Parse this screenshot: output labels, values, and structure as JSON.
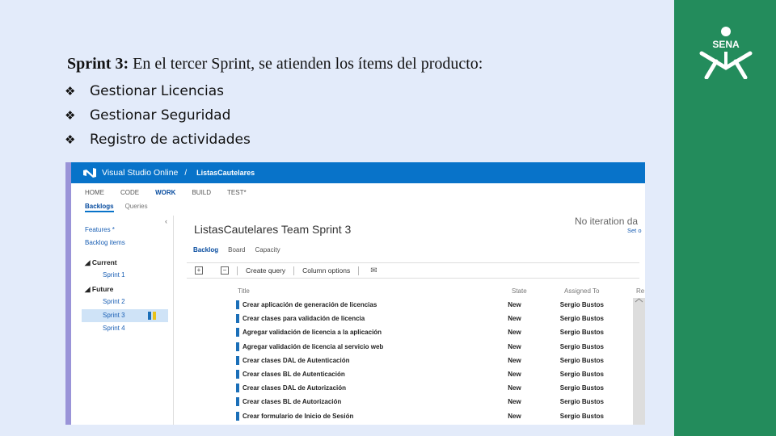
{
  "slide": {
    "heading_bold": "Sprint 3:",
    "heading_rest": " En el tercer Sprint, se atienden los ítems del producto:",
    "bullets": [
      "Gestionar Licencias",
      "Gestionar Seguridad",
      "Registro de actividades"
    ],
    "logo_text": "SENA",
    "band_color": "#238c5c"
  },
  "vso": {
    "app_name": "Visual Studio Online",
    "separator": "/",
    "project": "ListasCautelares",
    "menu": [
      "HOME",
      "CODE",
      "WORK",
      "BUILD",
      "TEST*"
    ],
    "active_menu": "WORK",
    "submenu": [
      "Backlogs",
      "Queries"
    ],
    "left_nav": {
      "features": "Features *",
      "backlog_items": "Backlog items",
      "current_label": "◢ Current",
      "sprint1": "Sprint 1",
      "future_label": "◢ Future",
      "sprint2": "Sprint 2",
      "sprint3": "Sprint 3",
      "sprint4": "Sprint 4",
      "collapse_glyph": "‹"
    },
    "team_title": "ListasCautelares Team Sprint 3",
    "no_iteration": "No iteration da",
    "set_link": "Set o",
    "tabs": [
      "Backlog",
      "Board",
      "Capacity"
    ],
    "toolbar": {
      "expand_glyph": "+",
      "collapse_glyph": "−",
      "create_query": "Create query",
      "column_options": "Column options",
      "mail_glyph": "✉"
    },
    "columns": {
      "title": "Title",
      "state": "State",
      "assigned": "Assigned To",
      "remaining": "Re"
    },
    "rows": [
      {
        "title": "Crear aplicación de generación de licencias",
        "state": "New",
        "assigned": "Sergio Bustos"
      },
      {
        "title": "Crear clases para validación de licencia",
        "state": "New",
        "assigned": "Sergio Bustos"
      },
      {
        "title": "Agregar validación de licencia a la aplicación",
        "state": "New",
        "assigned": "Sergio Bustos"
      },
      {
        "title": "Agregar validación de licencia al servicio web",
        "state": "New",
        "assigned": "Sergio Bustos"
      },
      {
        "title": "Crear clases DAL de Autenticación",
        "state": "New",
        "assigned": "Sergio Bustos"
      },
      {
        "title": "Crear clases BL de Autenticación",
        "state": "New",
        "assigned": "Sergio Bustos"
      },
      {
        "title": "Crear clases DAL de Autorización",
        "state": "New",
        "assigned": "Sergio Bustos"
      },
      {
        "title": "Crear clases BL de Autorización",
        "state": "New",
        "assigned": "Sergio Bustos"
      },
      {
        "title": "Crear formulario de Inicio de Sesión",
        "state": "New",
        "assigned": "Sergio Bustos"
      }
    ],
    "accent_color": "#0873c9"
  }
}
